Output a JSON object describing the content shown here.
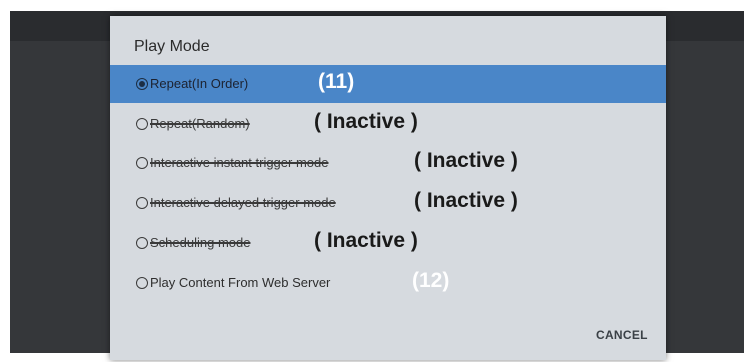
{
  "dialog": {
    "title": "Play Mode",
    "cancel_label": "CANCEL"
  },
  "options": [
    {
      "label": "Repeat(In Order)",
      "selected": true,
      "inactive": false,
      "annotation": "(11)"
    },
    {
      "label": "Repeat(Random)",
      "selected": false,
      "inactive": true,
      "annotation": "( Inactive )"
    },
    {
      "label": "Interactive instant trigger mode",
      "selected": false,
      "inactive": true,
      "annotation": "( Inactive )"
    },
    {
      "label": "Interactive delayed trigger mode",
      "selected": false,
      "inactive": true,
      "annotation": "( Inactive )"
    },
    {
      "label": "Scheduling mode",
      "selected": false,
      "inactive": true,
      "annotation": "( Inactive )"
    },
    {
      "label": "Play Content From Web Server",
      "selected": false,
      "inactive": false,
      "annotation": "(12)"
    }
  ],
  "colors": {
    "selected_row": "#4a86c8",
    "dialog_bg": "#d6dadf",
    "annotation_dark": "#1a1a1a",
    "annotation_light": "#ffffff"
  }
}
